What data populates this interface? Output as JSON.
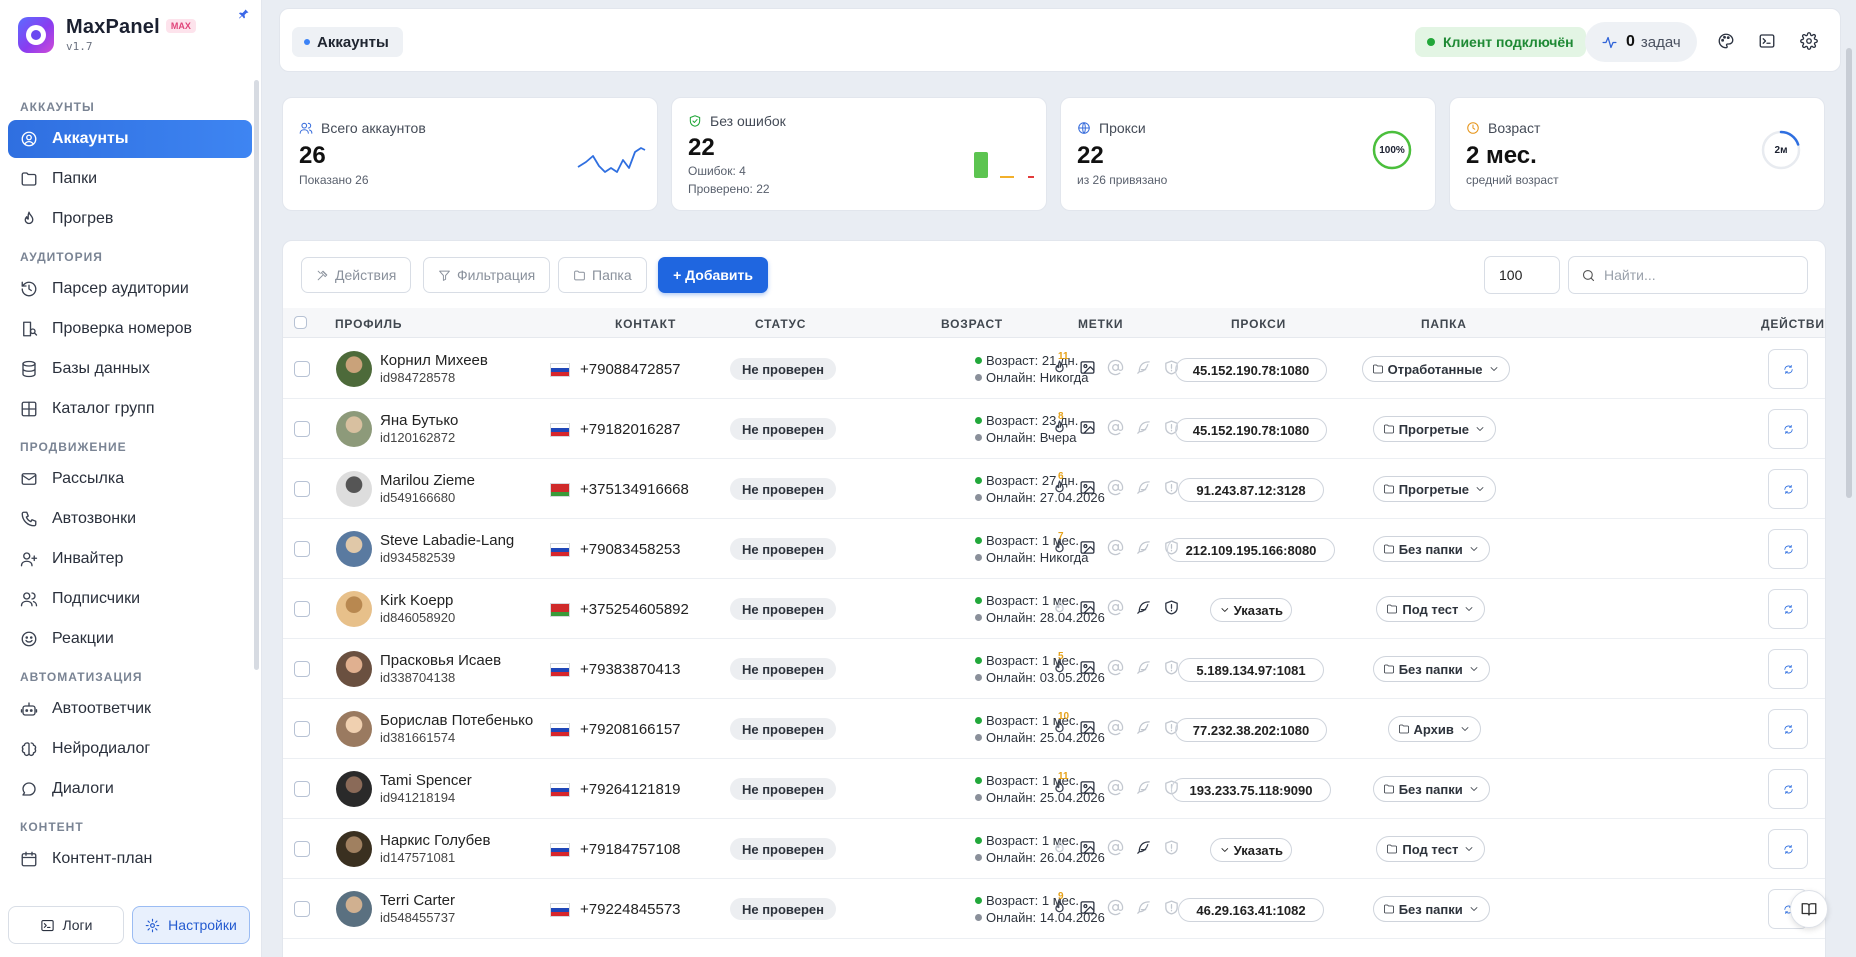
{
  "app": {
    "name": "MaxPanel",
    "badge": "MAX",
    "version": "v1.7"
  },
  "sidebar": {
    "sections": [
      {
        "title": "АККАУНТЫ",
        "items": [
          {
            "label": "Аккаунты",
            "icon": "user-circle-icon",
            "active": true
          },
          {
            "label": "Папки",
            "icon": "folder-icon"
          },
          {
            "label": "Прогрев",
            "icon": "flame-icon"
          }
        ]
      },
      {
        "title": "АУДИТОРИЯ",
        "items": [
          {
            "label": "Парсер аудитории",
            "icon": "history-icon"
          },
          {
            "label": "Проверка номеров",
            "icon": "phone-search-icon"
          },
          {
            "label": "Базы данных",
            "icon": "database-icon"
          },
          {
            "label": "Каталог групп",
            "icon": "grid-icon"
          }
        ]
      },
      {
        "title": "ПРОДВИЖЕНИЕ",
        "items": [
          {
            "label": "Рассылка",
            "icon": "mail-icon"
          },
          {
            "label": "Автозвонки",
            "icon": "phone-icon"
          },
          {
            "label": "Инвайтер",
            "icon": "user-plus-icon"
          },
          {
            "label": "Подписчики",
            "icon": "users-icon"
          },
          {
            "label": "Реакции",
            "icon": "smile-icon"
          }
        ]
      },
      {
        "title": "АВТОМАТИЗАЦИЯ",
        "items": [
          {
            "label": "Автоответчик",
            "icon": "bot-icon"
          },
          {
            "label": "Нейродиалог",
            "icon": "brain-icon"
          },
          {
            "label": "Диалоги",
            "icon": "chat-icon"
          }
        ]
      },
      {
        "title": "КОНТЕНТ",
        "items": [
          {
            "label": "Контент-план",
            "icon": "calendar-icon"
          }
        ]
      }
    ],
    "footer": {
      "logs": "Логи",
      "settings": "Настройки"
    }
  },
  "header": {
    "breadcrumb": "Аккаунты",
    "connection": "Клиент подключён",
    "tasks_count": "0",
    "tasks_label": "задач"
  },
  "stats": {
    "total": {
      "label": "Всего аккаунтов",
      "value": "26",
      "sub": "Показано 26"
    },
    "no_errors": {
      "label": "Без ошибок",
      "value": "22",
      "errors": "Ошибок: 4",
      "checked": "Проверено: 22"
    },
    "proxy": {
      "label": "Прокси",
      "value": "22",
      "sub": "из 26 привязано",
      "ring_label": "100%",
      "ring_fraction": 1.0
    },
    "age": {
      "label": "Возраст",
      "value": "2 мес.",
      "sub": "средний возраст",
      "ring_label": "2м",
      "ring_fraction": 0.2
    }
  },
  "toolbar": {
    "actions": "Действия",
    "filter": "Фильтрация",
    "folder": "Папка",
    "add": "+ Добавить",
    "per_page": "100",
    "search_placeholder": "Найти..."
  },
  "table": {
    "columns": [
      "ПРОФИЛЬ",
      "КОНТАКТ",
      "СТАТУС",
      "ВОЗРАСТ",
      "МЕТКИ",
      "ПРОКСИ",
      "ПАПКА",
      "ДЕЙСТВИЯ"
    ],
    "rows": [
      {
        "name": "Корнил Михеев",
        "id": "id984728578",
        "flag": "ru",
        "phone": "+79088472857",
        "status": "Не проверен",
        "age": "Возраст: 21 дн.",
        "online": "Онлайн: Никогда",
        "warm": "11",
        "tags_on": [
          false,
          true,
          false,
          false,
          false
        ],
        "proxy": "45.152.190.78:1080",
        "folder": "Отработанные"
      },
      {
        "name": "Яна Бутько",
        "id": "id120162872",
        "flag": "ru",
        "phone": "+79182016287",
        "status": "Не проверен",
        "age": "Возраст: 23 дн.",
        "online": "Онлайн: Вчера",
        "warm": "8",
        "tags_on": [
          false,
          true,
          false,
          false,
          false
        ],
        "proxy": "45.152.190.78:1080",
        "folder": "Прогретые"
      },
      {
        "name": "Marilou Zieme",
        "id": "id549166680",
        "flag": "by",
        "phone": "+375134916668",
        "status": "Не проверен",
        "age": "Возраст: 27 дн.",
        "online": "Онлайн: 27.04.2026",
        "warm": "6",
        "tags_on": [
          false,
          true,
          false,
          false,
          false
        ],
        "proxy": "91.243.87.12:3128",
        "folder": "Прогретые"
      },
      {
        "name": "Steve Labadie-Lang",
        "id": "id934582539",
        "flag": "ru",
        "phone": "+79083458253",
        "status": "Не проверен",
        "age": "Возраст: 1 мес.",
        "online": "Онлайн: Никогда",
        "warm": "7",
        "tags_on": [
          false,
          true,
          false,
          false,
          false
        ],
        "proxy": "212.109.195.166:8080",
        "folder": "Без папки"
      },
      {
        "name": "Kirk Koepp",
        "id": "id846058920",
        "flag": "by",
        "phone": "+375254605892",
        "status": "Не проверен",
        "age": "Возраст: 1 мес.",
        "online": "Онлайн: 28.04.2026",
        "warm": "",
        "tags_on": [
          false,
          true,
          false,
          true,
          true
        ],
        "proxy": "Указать",
        "folder": "Под тест"
      },
      {
        "name": "Прасковья Исаев",
        "id": "id338704138",
        "flag": "ru",
        "phone": "+79383870413",
        "status": "Не проверен",
        "age": "Возраст: 1 мес.",
        "online": "Онлайн: 03.05.2026",
        "warm": "5",
        "tags_on": [
          false,
          true,
          false,
          false,
          false
        ],
        "proxy": "5.189.134.97:1081",
        "folder": "Без папки"
      },
      {
        "name": "Борислав Потебенько",
        "id": "id381661574",
        "flag": "ru",
        "phone": "+79208166157",
        "status": "Не проверен",
        "age": "Возраст: 1 мес.",
        "online": "Онлайн: 25.04.2026",
        "warm": "10",
        "tags_on": [
          false,
          true,
          false,
          false,
          false
        ],
        "proxy": "77.232.38.202:1080",
        "folder": "Архив"
      },
      {
        "name": "Tami Spencer",
        "id": "id941218194",
        "flag": "ru",
        "phone": "+79264121819",
        "status": "Не проверен",
        "age": "Возраст: 1 мес.",
        "online": "Онлайн: 25.04.2026",
        "warm": "11",
        "tags_on": [
          false,
          true,
          false,
          false,
          false
        ],
        "proxy": "193.233.75.118:9090",
        "folder": "Без папки"
      },
      {
        "name": "Наркис Голубев",
        "id": "id147571081",
        "flag": "ru",
        "phone": "+79184757108",
        "status": "Не проверен",
        "age": "Возраст: 1 мес.",
        "online": "Онлайн: 26.04.2026",
        "warm": "",
        "tags_on": [
          false,
          true,
          false,
          true,
          false
        ],
        "proxy": "Указать",
        "folder": "Под тест"
      },
      {
        "name": "Terri Carter",
        "id": "id548455737",
        "flag": "ru",
        "phone": "+79224845573",
        "status": "Не проверен",
        "age": "Возраст: 1 мес.",
        "online": "Онлайн: 14.04.2026",
        "warm": "9",
        "tags_on": [
          false,
          true,
          false,
          false,
          false
        ],
        "proxy": "46.29.163.41:1082",
        "folder": "Без папки"
      }
    ]
  },
  "colors": {
    "accent": "#1f66e0",
    "online_green": "#22a73a",
    "offline_gray": "#8a909a",
    "warm_badge": "#e6a21a"
  }
}
